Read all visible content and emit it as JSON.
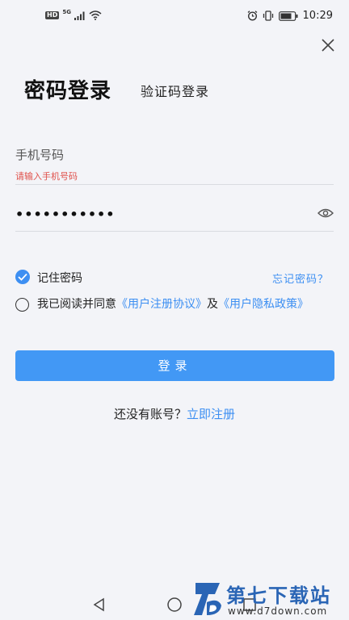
{
  "status_bar": {
    "hd": "HD",
    "network": "5G",
    "time": "10:29"
  },
  "tabs": {
    "password_login": "密码登录",
    "code_login": "验证码登录"
  },
  "phone": {
    "placeholder": "手机号码",
    "error": "请输入手机号码"
  },
  "password": {
    "value": "•••••••••••"
  },
  "remember": {
    "label": "记住密码",
    "checked": true
  },
  "forgot": "忘记密码？",
  "agreement": {
    "prefix": "我已阅读并同意",
    "user_agreement": "《用户注册协议》",
    "and": "及",
    "privacy_policy": "《用户隐私政策》",
    "checked": false
  },
  "login_button": "登录",
  "register": {
    "prompt": "还没有账号？",
    "link": "立即注册"
  },
  "watermark": {
    "title": "第七下载站",
    "url": "www.d7down.com"
  },
  "colors": {
    "accent": "#3d8ff2",
    "button": "#4298f5",
    "error": "#e0514b",
    "background": "#f3f4f8"
  }
}
